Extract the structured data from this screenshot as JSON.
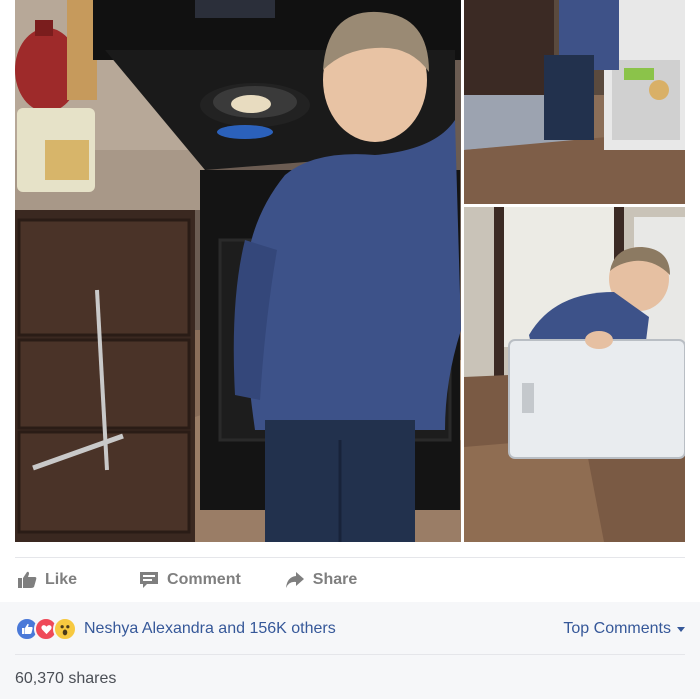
{
  "post": {
    "photos": [
      {
        "name": "boy-cooking-at-stove"
      },
      {
        "name": "boy-loading-dishwasher"
      },
      {
        "name": "boy-using-dryer"
      }
    ]
  },
  "actions": {
    "like": "Like",
    "comment": "Comment",
    "share": "Share"
  },
  "reactions": {
    "icons": [
      "like-reaction-icon",
      "love-reaction-icon",
      "wow-reaction-icon"
    ],
    "summary": "Neshya Alexandra and 156K others",
    "top_comments": "Top Comments"
  },
  "shares": "60,370 shares",
  "colors": {
    "link": "#365899",
    "action_text": "#7f7f7f",
    "like_blue": "#4a79d8",
    "love_red": "#ef4a59",
    "wow_yellow": "#f7c940",
    "footer_bg": "#f6f7f9"
  }
}
